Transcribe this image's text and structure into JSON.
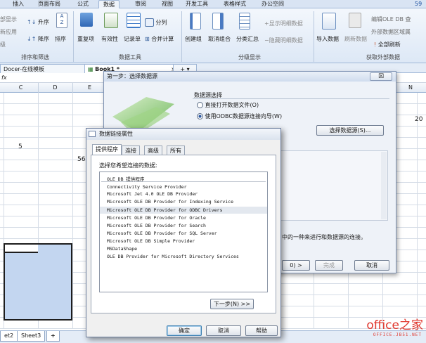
{
  "ribbon_tabs": [
    "插入",
    "页面布局",
    "公式",
    "数据",
    "审阅",
    "视图",
    "开发工具",
    "表格样式",
    "办公空间"
  ],
  "ribbon_active_tab": "数据",
  "ribbon_right_number": "59",
  "ribbon": {
    "left_partial": [
      "部显示",
      "新应用",
      "级"
    ],
    "sort_asc": "升序",
    "sort_desc": "降序",
    "sort": "排序",
    "remove_dup": "重复项",
    "validity": "有效性",
    "records": "记录单",
    "split": "分列",
    "consolidate": "合并计算",
    "group": "创建组",
    "ungroup": "取消组合",
    "subtotal": "分类汇总",
    "show_detail": "显示明细数据",
    "hide_detail": "隐藏明细数据",
    "import": "导入数据",
    "refresh": "刷新数据",
    "edit_oledb": "编辑OLE DB 查",
    "ext_range": "外部数据区域属",
    "refresh_all": "全部刷新",
    "group_sort": "排序和筛选",
    "group_data": "数据工具",
    "group_outline": "分级显示",
    "group_external": "获取外部数据"
  },
  "doc_tabs": [
    "Docer-在线模板",
    "Book1 *"
  ],
  "doc_tab_close": "×",
  "formula_fx": "fx",
  "columns": [
    "C",
    "D",
    "E",
    "N"
  ],
  "cells": {
    "c_val": "5",
    "e_val": "56",
    "n_val": "20"
  },
  "sheet_tabs": [
    "et2",
    "Sheet3",
    "+"
  ],
  "wizard": {
    "title": "第一步：选择数据源",
    "close": "☒",
    "section": "数据源选择",
    "opt_file": "直接打开数据文件(O)",
    "opt_odbc": "使用ODBC数据源连接向导(W)",
    "select_btn": "选择数据源(S)...",
    "note": "中的一种来进行和数据源的连接。",
    "next_btn": "0) >",
    "finish_btn": "完成",
    "cancel_btn": "取消"
  },
  "dlink": {
    "title": "数据链接属性",
    "tabs": [
      "提供程序",
      "连接",
      "高级",
      "所有"
    ],
    "prompt": "选择您希望连接的数据:",
    "list_header": "OLE DB 提供程序",
    "providers": [
      "Connectivity Service Provider",
      "Microsoft Jet 4.0 OLE DB Provider",
      "Microsoft OLE DB Provider for Indexing Service",
      "Microsoft OLE DB Provider for ODBC Drivers",
      "Microsoft OLE DB Provider for Oracle",
      "Microsoft OLE DB Provider for Search",
      "Microsoft OLE DB Provider for SQL Server",
      "Microsoft OLE DB Simple Provider",
      "MSDataShape",
      "OLE DB Provider for Microsoft Directory Services"
    ],
    "selected_index": 3,
    "next_btn": "下一步(N) >>",
    "ok": "确定",
    "cancel": "取消",
    "help": "帮助"
  },
  "watermark": {
    "main": "office之家",
    "sub": "OFFICE.JB51.NET"
  },
  "colors": {
    "accent": "#2b5797",
    "selection": "#c3d6f0",
    "watermark": "#e0362c"
  }
}
